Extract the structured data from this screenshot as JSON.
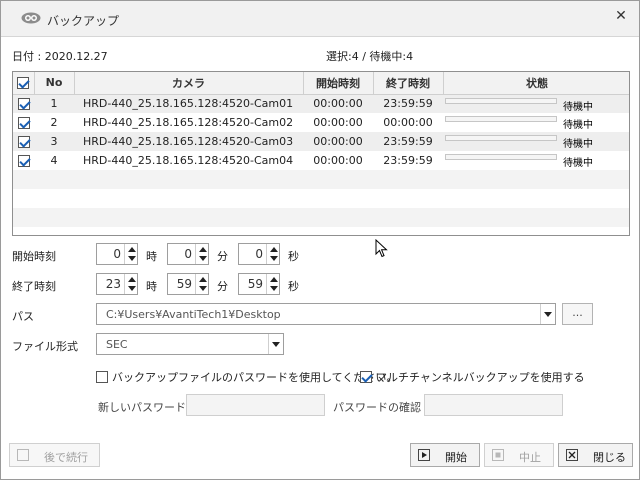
{
  "window": {
    "title": "バックアップ",
    "close_glyph": "✕"
  },
  "date_label": "日付 : 2020.12.27",
  "selection_status": "選択:4 / 待機中:4",
  "table": {
    "headers": {
      "no": "No",
      "camera": "カメラ",
      "start": "開始時刻",
      "end": "終了時刻",
      "status": "状態"
    },
    "rows": [
      {
        "no": "1",
        "camera": "HRD-440_25.18.165.128:4520-Cam01",
        "start": "00:00:00",
        "end": "23:59:59",
        "status": "待機中",
        "progress": 0
      },
      {
        "no": "2",
        "camera": "HRD-440_25.18.165.128:4520-Cam02",
        "start": "00:00:00",
        "end": "00:00:00",
        "status": "待機中",
        "progress": 0
      },
      {
        "no": "3",
        "camera": "HRD-440_25.18.165.128:4520-Cam03",
        "start": "00:00:00",
        "end": "23:59:59",
        "status": "待機中",
        "progress": 0
      },
      {
        "no": "4",
        "camera": "HRD-440_25.18.165.128:4520-Cam04",
        "start": "00:00:00",
        "end": "23:59:59",
        "status": "待機中",
        "progress": 0
      }
    ]
  },
  "start_time": {
    "label": "開始時刻",
    "hour": "0",
    "minute": "0",
    "second": "0"
  },
  "end_time": {
    "label": "終了時刻",
    "hour": "23",
    "minute": "59",
    "second": "59"
  },
  "units": {
    "hour": "時",
    "minute": "分",
    "second": "秒"
  },
  "path": {
    "label": "パス",
    "value": "C:¥Users¥AvantiTech1¥Desktop",
    "browse_label": "..."
  },
  "file_format": {
    "label": "ファイル形式",
    "value": "SEC"
  },
  "options": {
    "use_password_label": "バックアップファイルのパスワードを使用してください。",
    "use_password_checked": false,
    "multichannel_label": "マルチチャンネルバックアップを使用する",
    "multichannel_checked": true
  },
  "password": {
    "new_label": "新しいパスワード",
    "confirm_label": "パスワードの確認"
  },
  "buttons": {
    "later": "後で続行",
    "start": "開始",
    "stop": "中止",
    "close": "閉じる"
  },
  "colors": {
    "progress_fill": "#2e8b57",
    "check_mark": "#1a5fb4"
  }
}
